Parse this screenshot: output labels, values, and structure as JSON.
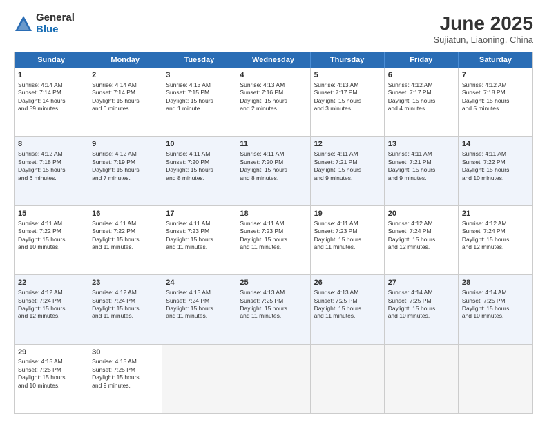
{
  "logo": {
    "general": "General",
    "blue": "Blue"
  },
  "title": "June 2025",
  "subtitle": "Sujiatun, Liaoning, China",
  "days": [
    "Sunday",
    "Monday",
    "Tuesday",
    "Wednesday",
    "Thursday",
    "Friday",
    "Saturday"
  ],
  "rows": [
    [
      {
        "num": "1",
        "lines": [
          "Sunrise: 4:14 AM",
          "Sunset: 7:14 PM",
          "Daylight: 14 hours",
          "and 59 minutes."
        ]
      },
      {
        "num": "2",
        "lines": [
          "Sunrise: 4:14 AM",
          "Sunset: 7:14 PM",
          "Daylight: 15 hours",
          "and 0 minutes."
        ]
      },
      {
        "num": "3",
        "lines": [
          "Sunrise: 4:13 AM",
          "Sunset: 7:15 PM",
          "Daylight: 15 hours",
          "and 1 minute."
        ]
      },
      {
        "num": "4",
        "lines": [
          "Sunrise: 4:13 AM",
          "Sunset: 7:16 PM",
          "Daylight: 15 hours",
          "and 2 minutes."
        ]
      },
      {
        "num": "5",
        "lines": [
          "Sunrise: 4:13 AM",
          "Sunset: 7:17 PM",
          "Daylight: 15 hours",
          "and 3 minutes."
        ]
      },
      {
        "num": "6",
        "lines": [
          "Sunrise: 4:12 AM",
          "Sunset: 7:17 PM",
          "Daylight: 15 hours",
          "and 4 minutes."
        ]
      },
      {
        "num": "7",
        "lines": [
          "Sunrise: 4:12 AM",
          "Sunset: 7:18 PM",
          "Daylight: 15 hours",
          "and 5 minutes."
        ]
      }
    ],
    [
      {
        "num": "8",
        "lines": [
          "Sunrise: 4:12 AM",
          "Sunset: 7:18 PM",
          "Daylight: 15 hours",
          "and 6 minutes."
        ]
      },
      {
        "num": "9",
        "lines": [
          "Sunrise: 4:12 AM",
          "Sunset: 7:19 PM",
          "Daylight: 15 hours",
          "and 7 minutes."
        ]
      },
      {
        "num": "10",
        "lines": [
          "Sunrise: 4:11 AM",
          "Sunset: 7:20 PM",
          "Daylight: 15 hours",
          "and 8 minutes."
        ]
      },
      {
        "num": "11",
        "lines": [
          "Sunrise: 4:11 AM",
          "Sunset: 7:20 PM",
          "Daylight: 15 hours",
          "and 8 minutes."
        ]
      },
      {
        "num": "12",
        "lines": [
          "Sunrise: 4:11 AM",
          "Sunset: 7:21 PM",
          "Daylight: 15 hours",
          "and 9 minutes."
        ]
      },
      {
        "num": "13",
        "lines": [
          "Sunrise: 4:11 AM",
          "Sunset: 7:21 PM",
          "Daylight: 15 hours",
          "and 9 minutes."
        ]
      },
      {
        "num": "14",
        "lines": [
          "Sunrise: 4:11 AM",
          "Sunset: 7:22 PM",
          "Daylight: 15 hours",
          "and 10 minutes."
        ]
      }
    ],
    [
      {
        "num": "15",
        "lines": [
          "Sunrise: 4:11 AM",
          "Sunset: 7:22 PM",
          "Daylight: 15 hours",
          "and 10 minutes."
        ]
      },
      {
        "num": "16",
        "lines": [
          "Sunrise: 4:11 AM",
          "Sunset: 7:22 PM",
          "Daylight: 15 hours",
          "and 11 minutes."
        ]
      },
      {
        "num": "17",
        "lines": [
          "Sunrise: 4:11 AM",
          "Sunset: 7:23 PM",
          "Daylight: 15 hours",
          "and 11 minutes."
        ]
      },
      {
        "num": "18",
        "lines": [
          "Sunrise: 4:11 AM",
          "Sunset: 7:23 PM",
          "Daylight: 15 hours",
          "and 11 minutes."
        ]
      },
      {
        "num": "19",
        "lines": [
          "Sunrise: 4:11 AM",
          "Sunset: 7:23 PM",
          "Daylight: 15 hours",
          "and 11 minutes."
        ]
      },
      {
        "num": "20",
        "lines": [
          "Sunrise: 4:12 AM",
          "Sunset: 7:24 PM",
          "Daylight: 15 hours",
          "and 12 minutes."
        ]
      },
      {
        "num": "21",
        "lines": [
          "Sunrise: 4:12 AM",
          "Sunset: 7:24 PM",
          "Daylight: 15 hours",
          "and 12 minutes."
        ]
      }
    ],
    [
      {
        "num": "22",
        "lines": [
          "Sunrise: 4:12 AM",
          "Sunset: 7:24 PM",
          "Daylight: 15 hours",
          "and 12 minutes."
        ]
      },
      {
        "num": "23",
        "lines": [
          "Sunrise: 4:12 AM",
          "Sunset: 7:24 PM",
          "Daylight: 15 hours",
          "and 11 minutes."
        ]
      },
      {
        "num": "24",
        "lines": [
          "Sunrise: 4:13 AM",
          "Sunset: 7:24 PM",
          "Daylight: 15 hours",
          "and 11 minutes."
        ]
      },
      {
        "num": "25",
        "lines": [
          "Sunrise: 4:13 AM",
          "Sunset: 7:25 PM",
          "Daylight: 15 hours",
          "and 11 minutes."
        ]
      },
      {
        "num": "26",
        "lines": [
          "Sunrise: 4:13 AM",
          "Sunset: 7:25 PM",
          "Daylight: 15 hours",
          "and 11 minutes."
        ]
      },
      {
        "num": "27",
        "lines": [
          "Sunrise: 4:14 AM",
          "Sunset: 7:25 PM",
          "Daylight: 15 hours",
          "and 10 minutes."
        ]
      },
      {
        "num": "28",
        "lines": [
          "Sunrise: 4:14 AM",
          "Sunset: 7:25 PM",
          "Daylight: 15 hours",
          "and 10 minutes."
        ]
      }
    ],
    [
      {
        "num": "29",
        "lines": [
          "Sunrise: 4:15 AM",
          "Sunset: 7:25 PM",
          "Daylight: 15 hours",
          "and 10 minutes."
        ]
      },
      {
        "num": "30",
        "lines": [
          "Sunrise: 4:15 AM",
          "Sunset: 7:25 PM",
          "Daylight: 15 hours",
          "and 9 minutes."
        ]
      },
      {
        "num": "",
        "lines": []
      },
      {
        "num": "",
        "lines": []
      },
      {
        "num": "",
        "lines": []
      },
      {
        "num": "",
        "lines": []
      },
      {
        "num": "",
        "lines": []
      }
    ]
  ],
  "row_alt": [
    false,
    true,
    false,
    true,
    false
  ]
}
